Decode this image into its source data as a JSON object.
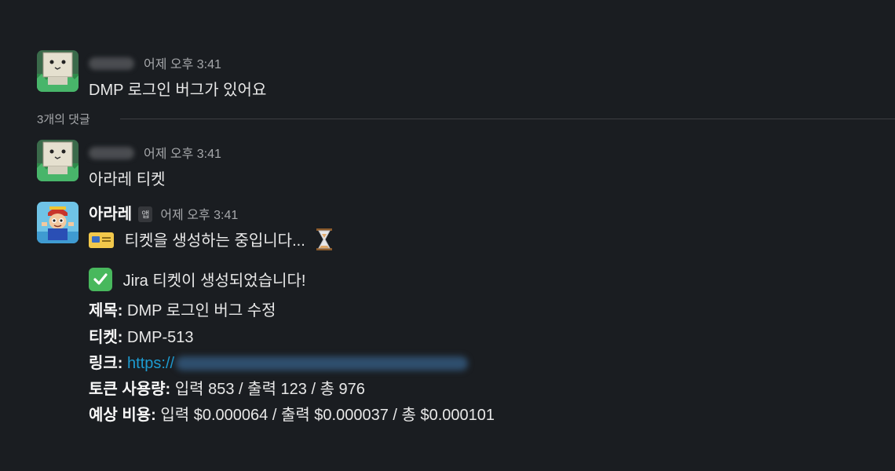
{
  "messages": [
    {
      "time": "어제 오후 3:41",
      "text": "DMP 로그인 버그가 있어요"
    }
  ],
  "thread": {
    "reply_count_label": "3개의 댓글",
    "replies": [
      {
        "time": "어제 오후 3:41",
        "text": "아라레 티켓"
      },
      {
        "author": "아라레",
        "badge": "앱",
        "time": "어제 오후 3:41",
        "status_line": "티켓을 생성하는 중입니다...",
        "success_line": "Jira 티켓이 생성되었습니다!",
        "fields": [
          {
            "label": "제목:",
            "value": " DMP 로그인 버그 수정"
          },
          {
            "label": "티켓:",
            "value": " DMP-513"
          },
          {
            "label": "링크:",
            "value": " https://"
          },
          {
            "label": "토큰 사용량:",
            "value": " 입력 853 / 출력 123 / 총 976"
          },
          {
            "label": "예상 비용:",
            "value": " 입력 $0.000064 / 출력 $0.000037 / 총 $0.000101"
          }
        ]
      }
    ]
  },
  "colors": {
    "background": "#1a1d21",
    "link": "#1d9bd1",
    "check": "#48b85d"
  },
  "icons": {
    "ticket_emoji": "admission-tickets-icon",
    "hourglass_emoji": "hourglass-icon",
    "check_emoji": "white-check-mark-icon"
  }
}
